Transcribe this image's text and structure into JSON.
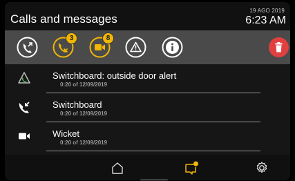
{
  "header": {
    "title": "Calls and messages",
    "date": "19 AGO 2019",
    "time": "6:23 AM"
  },
  "toolbar": {
    "missed_calls_badge": "3",
    "video_messages_badge": "8",
    "accent_color": "#f2b705",
    "delete_color": "#e04040"
  },
  "list": {
    "items": [
      {
        "icon": "alert-call-icon",
        "name": "Switchboard: outside door alert",
        "meta": "0:20 of 12/09/2019"
      },
      {
        "icon": "phone-incoming-icon",
        "name": "Switchboard",
        "meta": "0:20 of 12/09/2019"
      },
      {
        "icon": "video-camera-icon",
        "name": "Wicket",
        "meta": "0:20 of 12/09/2019"
      }
    ]
  }
}
